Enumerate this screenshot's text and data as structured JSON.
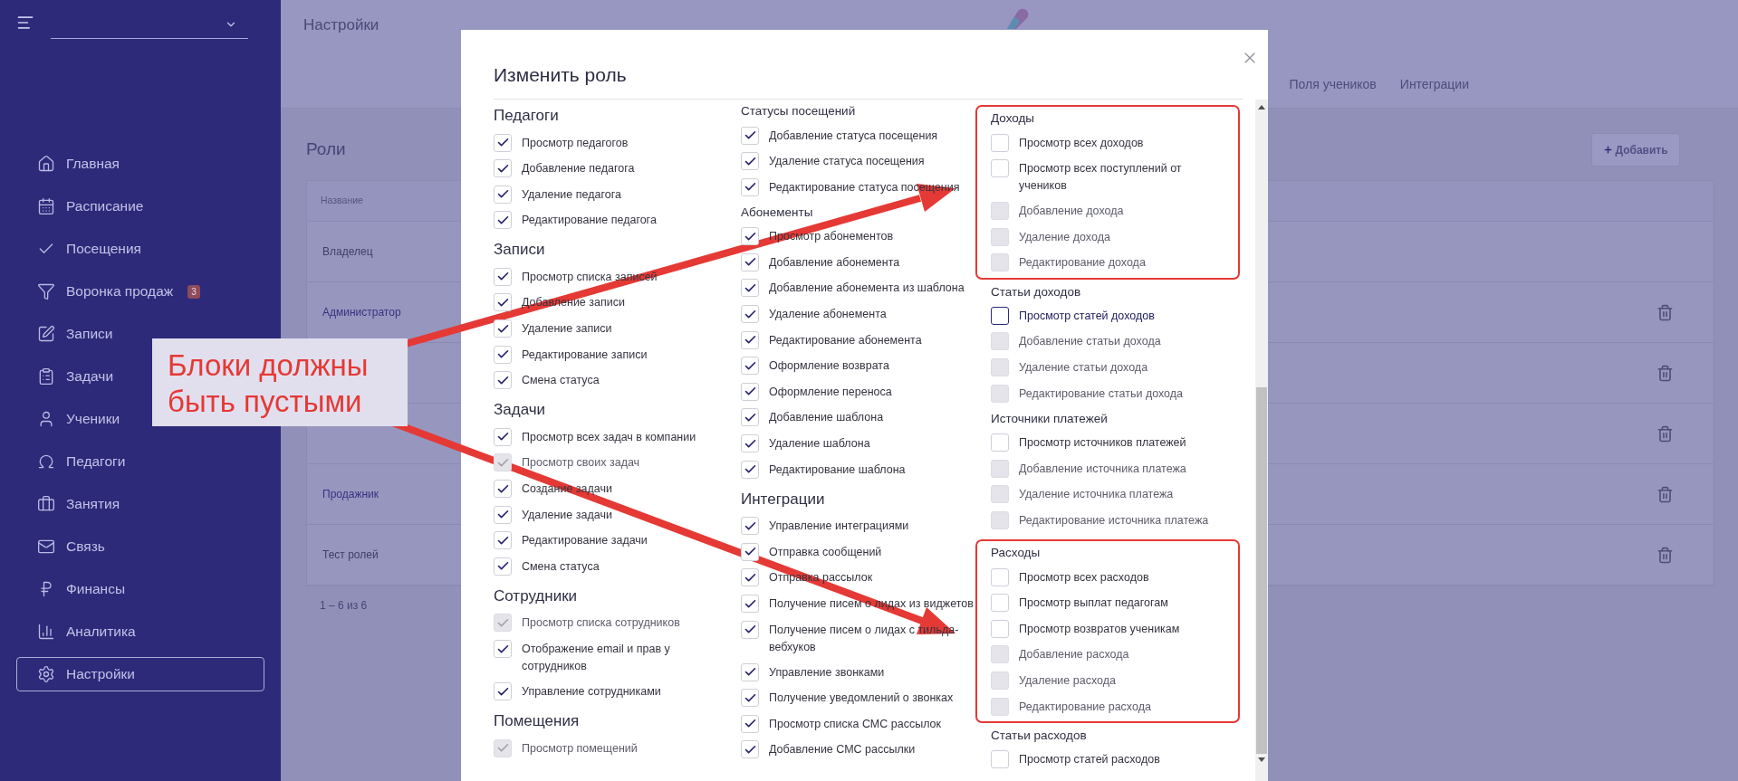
{
  "sidebar": {
    "items": [
      {
        "label": "Главная",
        "selected": false
      },
      {
        "label": "Расписание",
        "selected": false
      },
      {
        "label": "Посещения",
        "selected": false
      },
      {
        "label": "Воронка продаж",
        "selected": false,
        "badge": "3"
      },
      {
        "label": "Записи",
        "selected": false
      },
      {
        "label": "Задачи",
        "selected": false
      },
      {
        "label": "Ученики",
        "selected": false
      },
      {
        "label": "Педагоги",
        "selected": false
      },
      {
        "label": "Занятия",
        "selected": false
      },
      {
        "label": "Связь",
        "selected": false
      },
      {
        "label": "Финансы",
        "selected": false
      },
      {
        "label": "Аналитика",
        "selected": false
      },
      {
        "label": "Настройки",
        "selected": true
      }
    ]
  },
  "header": {
    "title": "Настройки",
    "tabs": [
      {
        "label": "Поля учеников",
        "selected": false
      },
      {
        "label": "Интеграции",
        "selected": false
      }
    ]
  },
  "roles": {
    "title": "Роли",
    "add_button": "Добавить",
    "columns": [
      "Название"
    ],
    "rows": [
      {
        "name": "Владелец",
        "link": false,
        "deletable": false
      },
      {
        "name": "Администратор",
        "link": true,
        "deletable": true
      },
      {
        "deletable": true
      },
      {
        "deletable": true
      },
      {
        "name": "Продажник",
        "link": true,
        "deletable": true
      },
      {
        "name": "Тест ролей",
        "link": false,
        "deletable": true
      }
    ],
    "pagination": "1 – 6 из 6"
  },
  "modal": {
    "title": "Изменить роль",
    "columns": [
      {
        "groups": [
          {
            "title": "Педагоги",
            "kind": "major",
            "highlighted": false,
            "items": [
              {
                "label": "Просмотр педагогов",
                "checked": true,
                "disabled": false
              },
              {
                "label": "Добавление педагога",
                "checked": true,
                "disabled": false
              },
              {
                "label": "Удаление педагога",
                "checked": true,
                "disabled": false
              },
              {
                "label": "Редактирование педагога",
                "checked": true,
                "disabled": false
              }
            ]
          },
          {
            "title": "Записи",
            "kind": "major",
            "highlighted": false,
            "items": [
              {
                "label": "Просмотр списка записей",
                "checked": true,
                "disabled": false
              },
              {
                "label": "Добавление записи",
                "checked": true,
                "disabled": false
              },
              {
                "label": "Удаление записи",
                "checked": true,
                "disabled": false
              },
              {
                "label": "Редактирование записи",
                "checked": true,
                "disabled": false
              },
              {
                "label": "Смена статуса",
                "checked": true,
                "disabled": false
              }
            ]
          },
          {
            "title": "Задачи",
            "kind": "major",
            "highlighted": false,
            "items": [
              {
                "label": "Просмотр всех задач в компании",
                "checked": true,
                "disabled": false
              },
              {
                "label": "Просмотр своих задач",
                "checked": true,
                "disabled": true
              },
              {
                "label": "Создание задачи",
                "checked": true,
                "disabled": false
              },
              {
                "label": "Удаление задачи",
                "checked": true,
                "disabled": false
              },
              {
                "label": "Редактирование задачи",
                "checked": true,
                "disabled": false
              },
              {
                "label": "Смена статуса",
                "checked": true,
                "disabled": false
              }
            ]
          },
          {
            "title": "Сотрудники",
            "kind": "major",
            "highlighted": false,
            "items": [
              {
                "label": "Просмотр списка сотрудников",
                "checked": true,
                "disabled": true
              },
              {
                "label": "Отображение email и прав у сотрудников",
                "checked": true,
                "disabled": false
              },
              {
                "label": "Управление сотрудниками",
                "checked": true,
                "disabled": false
              }
            ]
          },
          {
            "title": "Помещения",
            "kind": "major",
            "highlighted": false,
            "items": [
              {
                "label": "Просмотр помещений",
                "checked": true,
                "disabled": true
              }
            ]
          }
        ]
      },
      {
        "groups": [
          {
            "title": "Статусы посещений",
            "kind": "minor",
            "highlighted": false,
            "items": [
              {
                "label": "Добавление статуса посещения",
                "checked": true,
                "disabled": false
              },
              {
                "label": "Удаление статуса посещения",
                "checked": true,
                "disabled": false
              },
              {
                "label": "Редактирование статуса посещения",
                "checked": true,
                "disabled": false
              }
            ]
          },
          {
            "title": "Абонементы",
            "kind": "minor",
            "highlighted": false,
            "items": [
              {
                "label": "Просмотр абонементов",
                "checked": true,
                "disabled": false
              },
              {
                "label": "Добавление абонемента",
                "checked": true,
                "disabled": false
              },
              {
                "label": "Добавление абонемента из шаблона",
                "checked": true,
                "disabled": false
              },
              {
                "label": "Удаление абонемента",
                "checked": true,
                "disabled": false
              },
              {
                "label": "Редактирование абонемента",
                "checked": true,
                "disabled": false
              },
              {
                "label": "Оформление возврата",
                "checked": true,
                "disabled": false
              },
              {
                "label": "Оформление переноса",
                "checked": true,
                "disabled": false
              },
              {
                "label": "Добавление шаблона",
                "checked": true,
                "disabled": false
              },
              {
                "label": "Удаление шаблона",
                "checked": true,
                "disabled": false
              },
              {
                "label": "Редактирование шаблона",
                "checked": true,
                "disabled": false
              }
            ]
          },
          {
            "title": "Интеграции",
            "kind": "major",
            "highlighted": false,
            "items": [
              {
                "label": "Управление интеграциями",
                "checked": true,
                "disabled": false
              },
              {
                "label": "Отправка сообщений",
                "checked": true,
                "disabled": false
              },
              {
                "label": "Отправка рассылок",
                "checked": true,
                "disabled": false
              },
              {
                "label": "Получение писем о лидах из виджетов",
                "checked": true,
                "disabled": false
              },
              {
                "label": "Получение писем о лидах с тильда-вебхуков",
                "checked": true,
                "disabled": false
              },
              {
                "label": "Управление звонками",
                "checked": true,
                "disabled": false
              },
              {
                "label": "Получение уведомлений о звонках",
                "checked": true,
                "disabled": false
              },
              {
                "label": "Просмотр списка СМС рассылок",
                "checked": true,
                "disabled": false
              },
              {
                "label": "Добавление СМС рассылки",
                "checked": true,
                "disabled": false
              }
            ]
          }
        ]
      },
      {
        "groups": [
          {
            "title": "Доходы",
            "kind": "minor",
            "highlighted": true,
            "items": [
              {
                "label": "Просмотр всех доходов",
                "checked": false,
                "disabled": false
              },
              {
                "label": "Просмотр всех поступлений от учеников",
                "checked": false,
                "disabled": false
              },
              {
                "label": "Добавление дохода",
                "checked": false,
                "disabled": true
              },
              {
                "label": "Удаление дохода",
                "checked": false,
                "disabled": true
              },
              {
                "label": "Редактирование дохода",
                "checked": false,
                "disabled": true
              }
            ]
          },
          {
            "title": "Статьи доходов",
            "kind": "minor",
            "highlighted": false,
            "items": [
              {
                "label": "Просмотр статей доходов",
                "checked": false,
                "disabled": false,
                "focused": true
              },
              {
                "label": "Добавление статьи дохода",
                "checked": false,
                "disabled": true,
                "focused": false
              },
              {
                "label": "Удаление статьи дохода",
                "checked": false,
                "disabled": true,
                "focused": false
              },
              {
                "label": "Редактирование статьи дохода",
                "checked": false,
                "disabled": true,
                "focused": false
              }
            ]
          },
          {
            "title": "Источники платежей",
            "kind": "minor",
            "highlighted": false,
            "items": [
              {
                "label": "Просмотр источников платежей",
                "checked": false,
                "disabled": false
              },
              {
                "label": "Добавление источника платежа",
                "checked": false,
                "disabled": true
              },
              {
                "label": "Удаление источника платежа",
                "checked": false,
                "disabled": true
              },
              {
                "label": "Редактирование источника платежа",
                "checked": false,
                "disabled": true
              }
            ]
          },
          {
            "title": "Расходы",
            "kind": "minor",
            "highlighted": true,
            "items": [
              {
                "label": "Просмотр всех расходов",
                "checked": false,
                "disabled": false
              },
              {
                "label": "Просмотр выплат педагогам",
                "checked": false,
                "disabled": false
              },
              {
                "label": "Просмотр возвратов ученикам",
                "checked": false,
                "disabled": false
              },
              {
                "label": "Добавление расхода",
                "checked": false,
                "disabled": true
              },
              {
                "label": "Удаление расхода",
                "checked": false,
                "disabled": true
              },
              {
                "label": "Редактирование расхода",
                "checked": false,
                "disabled": true
              }
            ]
          },
          {
            "title": "Статьи расходов",
            "kind": "minor",
            "highlighted": false,
            "items": [
              {
                "label": "Просмотр статей расходов",
                "checked": false,
                "disabled": false
              }
            ]
          }
        ]
      }
    ]
  },
  "annotation": {
    "text": "Блоки должны быть пустыми"
  }
}
